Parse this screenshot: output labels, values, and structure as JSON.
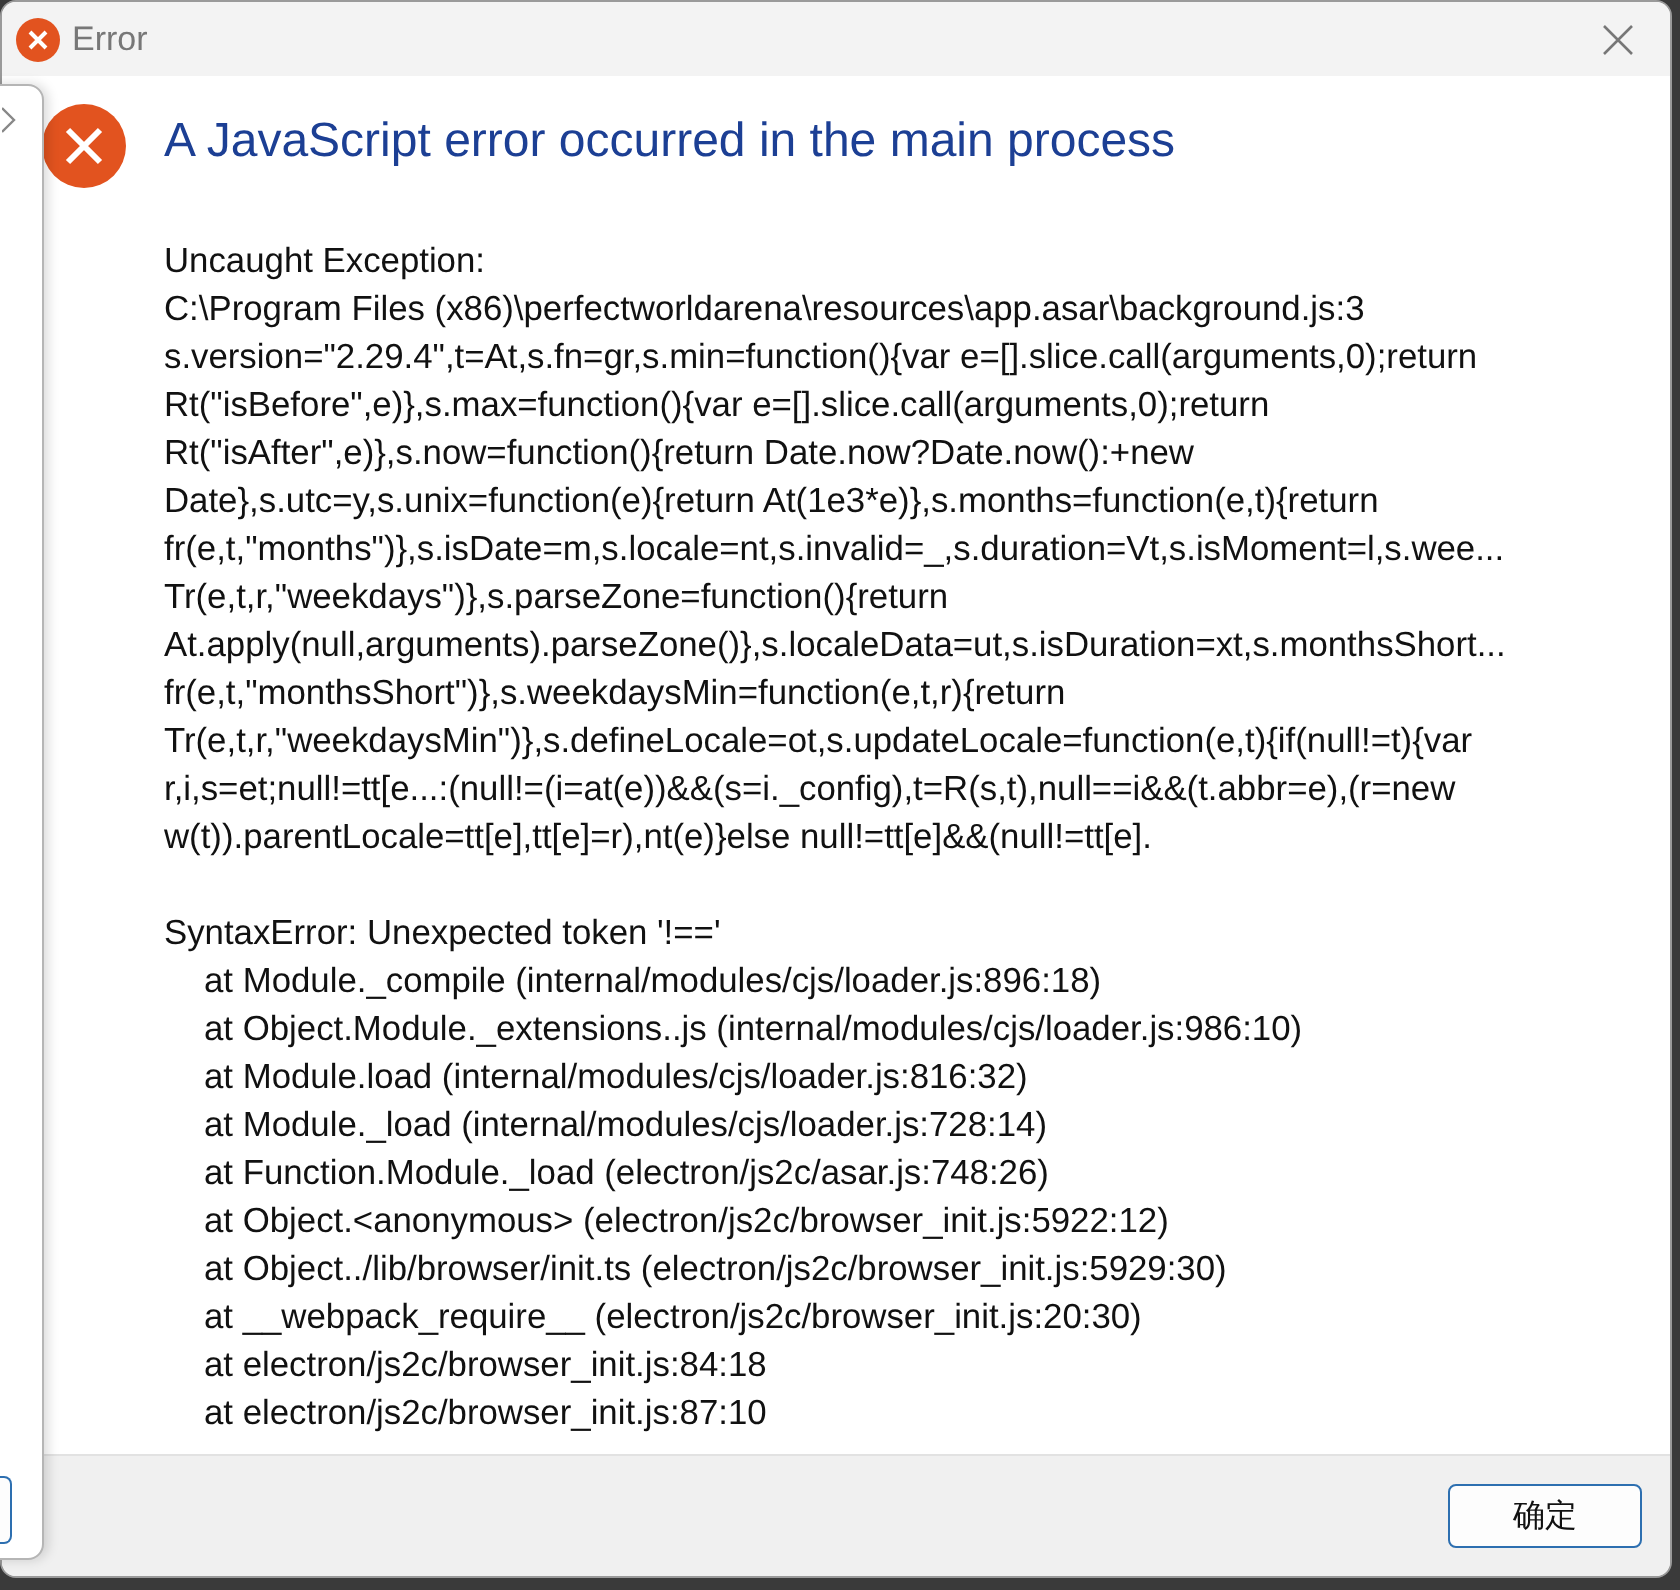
{
  "window": {
    "title": "Error"
  },
  "heading": "A JavaScript error occurred in the main process",
  "exception": {
    "label": "Uncaught Exception:",
    "lines": [
      "C:\\Program Files (x86)\\perfectworldarena\\resources\\app.asar\\background.js:3",
      "s.version=\"2.29.4\",t=At,s.fn=gr,s.min=function(){var e=[].slice.call(arguments,0);return",
      "Rt(\"isBefore\",e)},s.max=function(){var e=[].slice.call(arguments,0);return",
      "Rt(\"isAfter\",e)},s.now=function(){return Date.now?Date.now():+new",
      "Date},s.utc=y,s.unix=function(e){return At(1e3*e)},s.months=function(e,t){return",
      "fr(e,t,\"months\")},s.isDate=m,s.locale=nt,s.invalid=_,s.duration=Vt,s.isMoment=l,s.wee...",
      "Tr(e,t,r,\"weekdays\")},s.parseZone=function(){return",
      "At.apply(null,arguments).parseZone()},s.localeData=ut,s.isDuration=xt,s.monthsShort...",
      "fr(e,t,\"monthsShort\")},s.weekdaysMin=function(e,t,r){return",
      "Tr(e,t,r,\"weekdaysMin\")},s.defineLocale=ot,s.updateLocale=function(e,t){if(null!=t){var",
      "r,i,s=et;null!=tt[e...:(null!=(i=at(e))&&(s=i._config),t=R(s,t),null==i&&(t.abbr=e),(r=new",
      "w(t)).parentLocale=tt[e],tt[e]=r),nt(e)}else null!=tt[e]&&(null!=tt[e]."
    ]
  },
  "error": {
    "message": "SyntaxError: Unexpected token '!=='",
    "stack": [
      "at Module._compile (internal/modules/cjs/loader.js:896:18)",
      "at Object.Module._extensions..js (internal/modules/cjs/loader.js:986:10)",
      "at Module.load (internal/modules/cjs/loader.js:816:32)",
      "at Module._load (internal/modules/cjs/loader.js:728:14)",
      "at Function.Module._load (electron/js2c/asar.js:748:26)",
      "at Object.<anonymous> (electron/js2c/browser_init.js:5922:12)",
      "at Object../lib/browser/init.ts (electron/js2c/browser_init.js:5929:30)",
      "at __webpack_require__ (electron/js2c/browser_init.js:20:30)",
      "at electron/js2c/browser_init.js:84:18",
      "at electron/js2c/browser_init.js:87:10"
    ]
  },
  "buttons": [
    "确定"
  ]
}
